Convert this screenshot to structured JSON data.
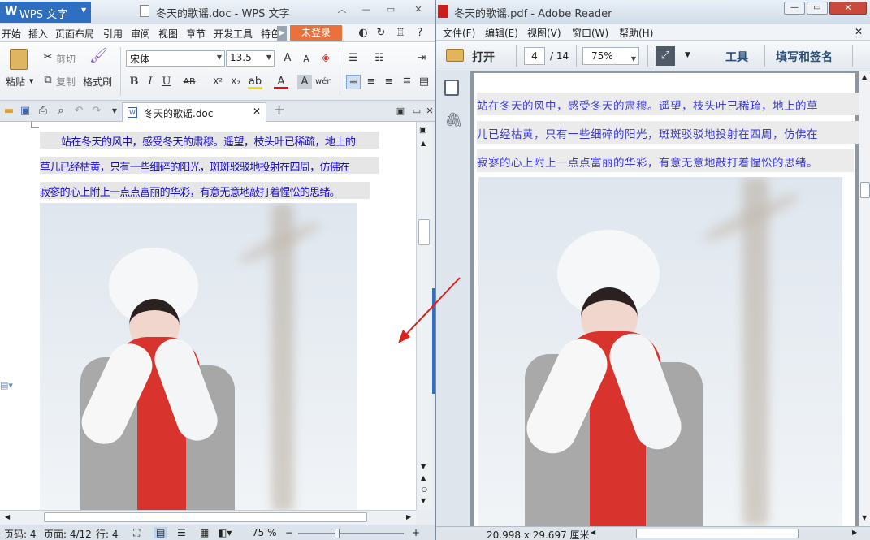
{
  "wps": {
    "app_button": "WPS 文字",
    "title": "冬天的歌谣.doc - WPS 文字",
    "menu": [
      "开始",
      "插入",
      "页面布局",
      "引用",
      "审阅",
      "视图",
      "章节",
      "开发工具",
      "特色"
    ],
    "login": "未登录",
    "ribbon": {
      "paste": "粘贴",
      "cut": "剪切",
      "copy": "复制",
      "format_painter": "格式刷",
      "font_name": "宋体",
      "font_size": "13.5"
    },
    "doc_tab": "冬天的歌谣.doc",
    "doc_lines": [
      "站在冬天的风中，感受冬天的肃穆。遥望，枝头叶已稀疏，地上的",
      "草儿已经枯黄，只有一些细碎的阳光，斑斑驳驳地投射在四周，仿佛在",
      "寂寥的心上附上一点点富丽的华彩，有意无意地敲打着惺忪的思绪。"
    ],
    "status": {
      "page_no": "页码: 4",
      "page": "页面: 4/12",
      "row": "行: 4",
      "zoom": "75 %"
    }
  },
  "pdf": {
    "title": "冬天的歌谣.pdf - Adobe Reader",
    "menu": [
      "文件(F)",
      "编辑(E)",
      "视图(V)",
      "窗口(W)",
      "帮助(H)"
    ],
    "toolbar": {
      "open": "打开",
      "page_current": "4",
      "page_total": "/ 14",
      "zoom": "75%",
      "tools": "工具",
      "fill_sign": "填写和签名"
    },
    "page_lines": [
      "站在冬天的风中，感受冬天的肃穆。遥望，枝头叶已稀疏，地上的草",
      "儿已经枯黄，只有一些细碎的阳光，斑斑驳驳地投射在四周，仿佛在",
      "寂寥的心上附上一点点富丽的华彩，有意无意地敲打着惺忪的思绪。"
    ],
    "status_size": "20.998 x 29.697 厘米"
  },
  "colors": {
    "wps_blue": "#2f6fc1",
    "login_orange": "#e9713b",
    "text_blue": "#1a0dcc",
    "scarf_red": "#d8332c",
    "arrow_red": "#e0201b"
  }
}
